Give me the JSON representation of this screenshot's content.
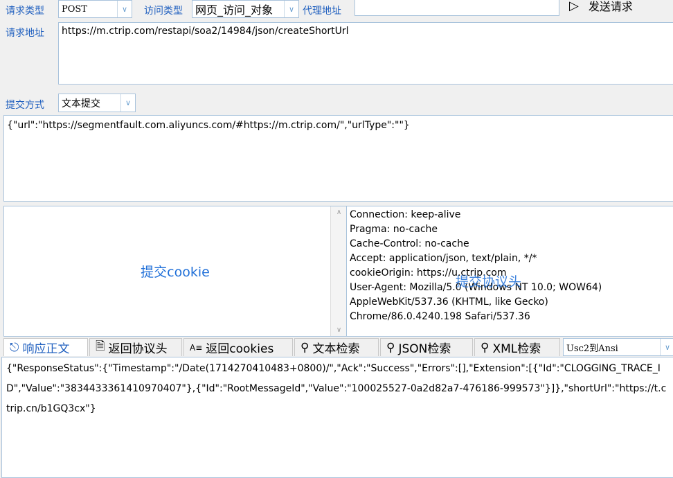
{
  "request": {
    "type_label": "请求类型",
    "type_value": "POST",
    "access_label": "访问类型",
    "access_value": "网页_访问_对象",
    "proxy_label": "代理地址",
    "proxy_value": "",
    "send_label": "发送请求",
    "url_label": "请求地址",
    "url_value": "https://m.ctrip.com/restapi/soa2/14984/json/createShortUrl",
    "submit_label": "提交方式",
    "submit_value": "文本提交",
    "body": "{\"url\":\"https://segmentfault.com.aliyuncs.com/#https://m.ctrip.com/\",\"urlType\":\"\"}"
  },
  "cookie": {
    "placeholder": "提交cookie"
  },
  "headers": {
    "overlay": "提交协议头",
    "lines": [
      "Connection: keep-alive",
      "Pragma: no-cache",
      "Cache-Control: no-cache",
      "Accept: application/json, text/plain, */*",
      "cookieOrigin: https://u.ctrip.com",
      "User-Agent: Mozilla/5.0 (Windows NT 10.0; WOW64)",
      "AppleWebKit/537.36 (KHTML, like Gecko)",
      "Chrome/86.0.4240.198 Safari/537.36"
    ]
  },
  "tabs": [
    {
      "label": "响应正文"
    },
    {
      "label": "返回协议头"
    },
    {
      "label": "返回cookies"
    },
    {
      "label": "文本检索"
    },
    {
      "label": "JSON检索"
    },
    {
      "label": "XML检索"
    }
  ],
  "encoding": "Usc2到Ansi",
  "response": "{\"ResponseStatus\":{\"Timestamp\":\"/Date(1714270410483+0800)/\",\"Ack\":\"Success\",\"Errors\":[],\"Extension\":[{\"Id\":\"CLOGGING_TRACE_ID\",\"Value\":\"3834433361410970407\"},{\"Id\":\"RootMessageId\",\"Value\":\"100025527-0a2d82a7-476186-999573\"}]},\"shortUrl\":\"https://t.ctrip.cn/b1GQ3cx\"}"
}
